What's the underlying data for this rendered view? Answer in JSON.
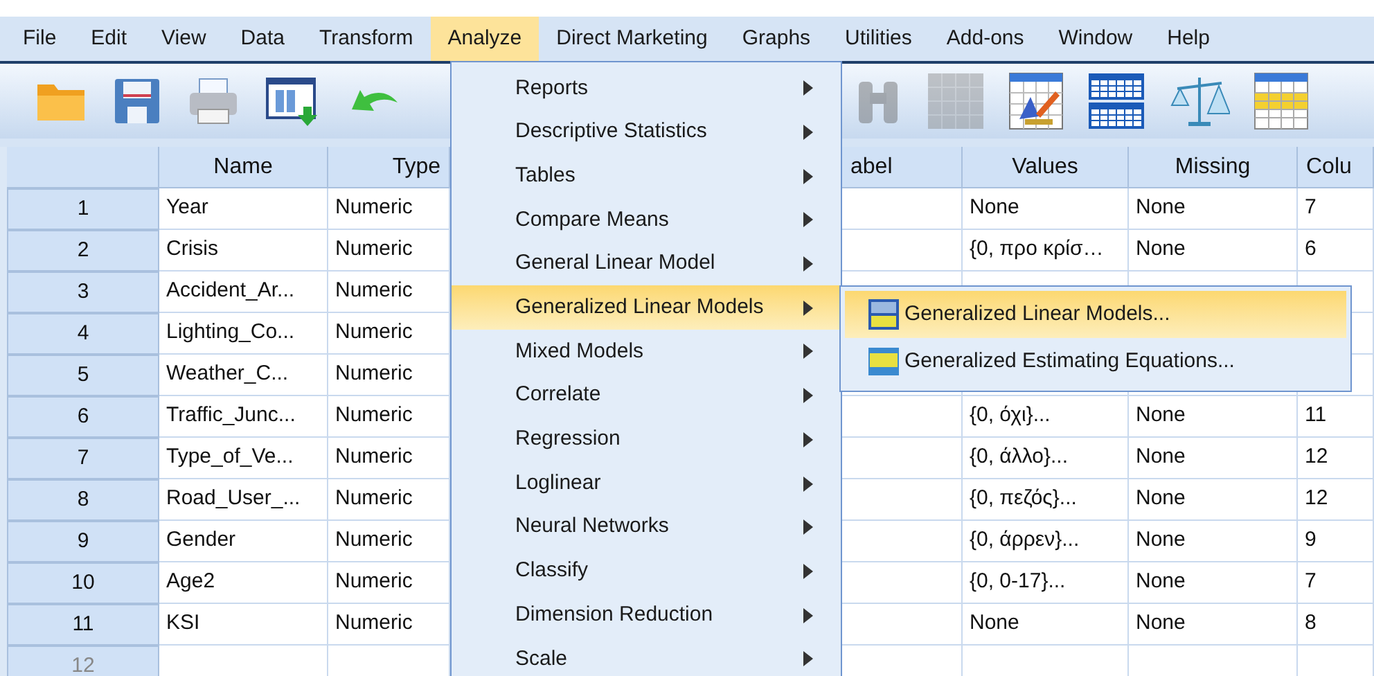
{
  "menubar": [
    {
      "label": "File",
      "selected": false
    },
    {
      "label": "Edit",
      "selected": false
    },
    {
      "label": "View",
      "selected": false
    },
    {
      "label": "Data",
      "selected": false
    },
    {
      "label": "Transform",
      "selected": false
    },
    {
      "label": "Analyze",
      "selected": true
    },
    {
      "label": "Direct Marketing",
      "selected": false
    },
    {
      "label": "Graphs",
      "selected": false
    },
    {
      "label": "Utilities",
      "selected": false
    },
    {
      "label": "Add-ons",
      "selected": false
    },
    {
      "label": "Window",
      "selected": false
    },
    {
      "label": "Help",
      "selected": false
    }
  ],
  "toolbar": [
    {
      "kind": "folder",
      "disabled": false
    },
    {
      "kind": "save",
      "disabled": false
    },
    {
      "kind": "print",
      "disabled": false
    },
    {
      "kind": "recall",
      "disabled": false
    },
    {
      "kind": "undo",
      "disabled": false
    },
    {
      "kind": "gap"
    },
    {
      "kind": "find",
      "disabled": true
    },
    {
      "kind": "grid",
      "disabled": true
    },
    {
      "kind": "edit-table",
      "disabled": false
    },
    {
      "kind": "split",
      "disabled": false
    },
    {
      "kind": "scales",
      "disabled": false
    },
    {
      "kind": "yellow-table",
      "disabled": false
    }
  ],
  "table": {
    "columns": {
      "name": "Name",
      "type": "Type",
      "label": "abel",
      "values": "Values",
      "missing": "Missing",
      "columns": "Colu"
    },
    "rows": [
      {
        "number": "1",
        "name": "Year",
        "type": "Numeric",
        "values": "None",
        "missing": "None",
        "columns": "7"
      },
      {
        "number": "2",
        "name": "Crisis",
        "type": "Numeric",
        "values": "{0, προ κρίσ…",
        "missing": "None",
        "columns": "6"
      },
      {
        "number": "3",
        "name": "Accident_Ar...",
        "type": "Numeric"
      },
      {
        "number": "4",
        "name": "Lighting_Co...",
        "type": "Numeric"
      },
      {
        "number": "5",
        "name": "Weather_C...",
        "type": "Numeric"
      },
      {
        "number": "6",
        "name": "Traffic_Junc...",
        "type": "Numeric",
        "values": "{0, όχι}...",
        "missing": "None",
        "columns": "11"
      },
      {
        "number": "7",
        "name": "Type_of_Ve...",
        "type": "Numeric",
        "values": "{0, άλλο}...",
        "missing": "None",
        "columns": "12"
      },
      {
        "number": "8",
        "name": "Road_User_...",
        "type": "Numeric",
        "values": "{0, πεζός}...",
        "missing": "None",
        "columns": "12"
      },
      {
        "number": "9",
        "name": "Gender",
        "type": "Numeric",
        "values": "{0, άρρεν}...",
        "missing": "None",
        "columns": "9"
      },
      {
        "number": "10",
        "name": "Age2",
        "type": "Numeric",
        "values": "{0, 0-17}...",
        "missing": "None",
        "columns": "7"
      },
      {
        "number": "11",
        "name": "KSI",
        "type": "Numeric",
        "values": "None",
        "missing": "None",
        "columns": "8"
      },
      {
        "number": "12"
      }
    ]
  },
  "analyze_menu": [
    {
      "label": "Reports",
      "selected": false
    },
    {
      "label": "Descriptive Statistics",
      "selected": false
    },
    {
      "label": "Tables",
      "selected": false
    },
    {
      "label": "Compare Means",
      "selected": false
    },
    {
      "label": "General Linear Model",
      "selected": false
    },
    {
      "label": "Generalized Linear Models",
      "selected": true
    },
    {
      "label": "Mixed Models",
      "selected": false
    },
    {
      "label": "Correlate",
      "selected": false
    },
    {
      "label": "Regression",
      "selected": false
    },
    {
      "label": "Loglinear",
      "selected": false
    },
    {
      "label": "Neural Networks",
      "selected": false
    },
    {
      "label": "Classify",
      "selected": false
    },
    {
      "label": "Dimension Reduction",
      "selected": false
    },
    {
      "label": "Scale",
      "selected": false
    }
  ],
  "submenu": [
    {
      "label": "Generalized Linear Models...",
      "kind": "gzlm",
      "selected": true
    },
    {
      "label": "Generalized Estimating Equations...",
      "kind": "gee",
      "selected": false
    }
  ]
}
